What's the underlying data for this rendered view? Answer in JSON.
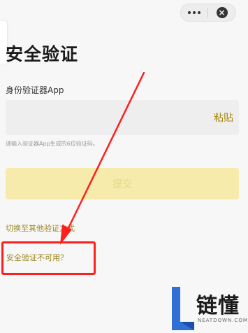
{
  "header": {
    "more_icon": "more-dots-icon",
    "close_icon": "close-circle-icon"
  },
  "page": {
    "title": "安全验证",
    "field_label": "身份验证器App",
    "paste_label": "粘贴",
    "hint": "请输入验证器App生成的6位验证码。",
    "submit_label": "提交",
    "switch_link": "切换至其他验证方式",
    "unavailable_link": "安全验证不可用？"
  },
  "annotation": {
    "color": "#ff1e1e"
  },
  "watermark": {
    "text": "链懂",
    "subtext": "NEATDOWN.COM"
  }
}
